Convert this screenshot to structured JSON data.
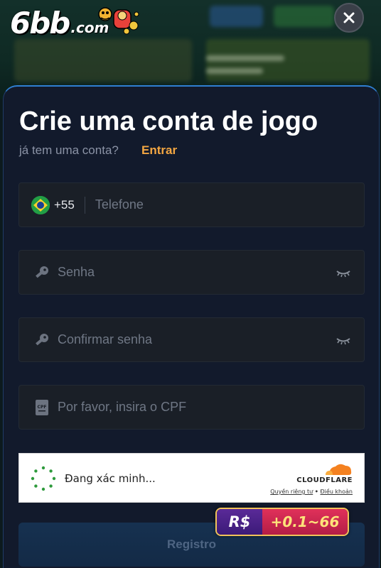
{
  "header": {
    "logo_main": "6bb",
    "logo_suffix": ".com",
    "close_icon": "close-icon"
  },
  "modal": {
    "title": "Crie uma conta de jogo",
    "subtitle": "já tem uma conta?",
    "login_link": "Entrar",
    "accent_color": "#f4a742"
  },
  "form": {
    "phone": {
      "flag_icon": "brazil-flag-icon",
      "country_code": "+55",
      "placeholder": "Telefone"
    },
    "password": {
      "icon": "key-icon",
      "placeholder": "Senha",
      "toggle_icon": "eye-closed-icon"
    },
    "confirm_password": {
      "icon": "key-icon",
      "placeholder": "Confirmar senha",
      "toggle_icon": "eye-closed-icon"
    },
    "cpf": {
      "icon": "cpf-card-icon",
      "badge": "CPF",
      "placeholder": "Por favor, insira o CPF"
    }
  },
  "captcha": {
    "status": "Đang xác minh...",
    "brand": "CLOUDFLARE",
    "privacy_link": "Quyền riêng tư",
    "separator": "•",
    "terms_link": "Điều khoản"
  },
  "register_button": {
    "label": "Registro"
  },
  "bonus": {
    "currency": "R$",
    "amount": "+0.1~66"
  }
}
